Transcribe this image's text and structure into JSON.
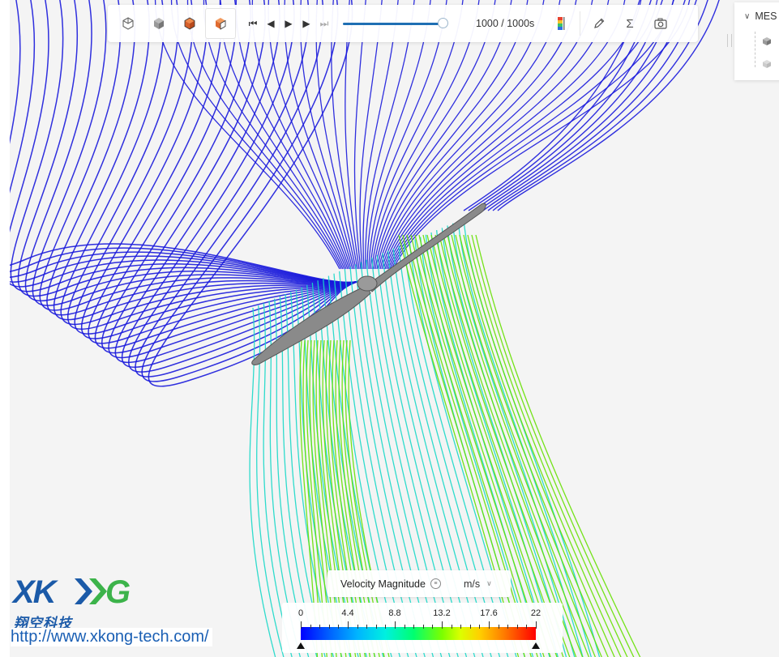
{
  "toolbar": {
    "view_buttons": [
      {
        "name": "view-wireframe-icon"
      },
      {
        "name": "view-solid-icon"
      },
      {
        "name": "view-mesh-icon"
      },
      {
        "name": "view-surface-icon"
      }
    ],
    "playback": {
      "first_icon": "skip-first-icon",
      "prev_icon": "step-back-icon",
      "play_icon": "play-icon",
      "next_icon": "step-forward-icon",
      "last_icon": "skip-last-icon"
    },
    "time_progress": 1.0,
    "time_label": "1000 / 1000s",
    "tools": [
      {
        "name": "color-legend-icon"
      },
      {
        "name": "probe-pen-icon"
      },
      {
        "name": "sum-icon"
      },
      {
        "name": "camera-screenshot-icon"
      }
    ]
  },
  "side_panel": {
    "header": "MES",
    "collapse_icon": "chevron-down-icon"
  },
  "legend": {
    "quantity": "Velocity Magnitude",
    "unit": "m/s",
    "ticks": [
      "0",
      "4.4",
      "8.8",
      "13.2",
      "17.6",
      "22"
    ],
    "range": [
      0,
      22
    ]
  },
  "branding": {
    "logo_text": "XKONG",
    "chinese_name": "翔空科技",
    "url": "http://www.xkong-tech.com/"
  },
  "colors": {
    "streamline_low": "#1a1adc",
    "streamline_mid": "#18d8c8",
    "streamline_high": "#66e000",
    "propeller": "#8a8a8a",
    "brand_blue": "#1b5aa8",
    "brand_green": "#3cb34a",
    "slider_fill": "#1f6fb3"
  }
}
